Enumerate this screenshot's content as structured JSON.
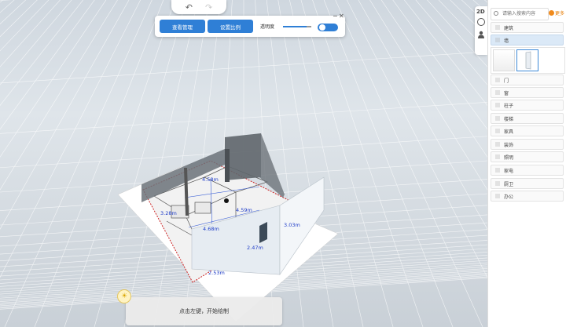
{
  "toolbar": {
    "view_management": "查看管理",
    "set_scale": "设置比例",
    "opacity_label": "透明度",
    "opacity_level": 0.82,
    "toggle_on": true
  },
  "dimensions": [
    "3.28m",
    "4.58m",
    "4.59m",
    "4.68m",
    "2.47m",
    "3.03m",
    "2.53m"
  ],
  "hint": {
    "text": "点击左键，开始绘制"
  },
  "watermark": "",
  "side": {
    "mode_2d": "2D"
  },
  "search": {
    "placeholder": "请输入搜索内容",
    "more": "更多"
  },
  "categories": [
    "建筑",
    "墙",
    "门",
    "窗",
    "柱子",
    "楼梯",
    "家具",
    "装饰",
    "照明",
    "家电",
    "厨卫",
    "办公"
  ],
  "active_category": "墙",
  "colors": {
    "accent": "#2f7fd6",
    "more": "#e57a00",
    "dimension_text": "#1f3dc8"
  }
}
